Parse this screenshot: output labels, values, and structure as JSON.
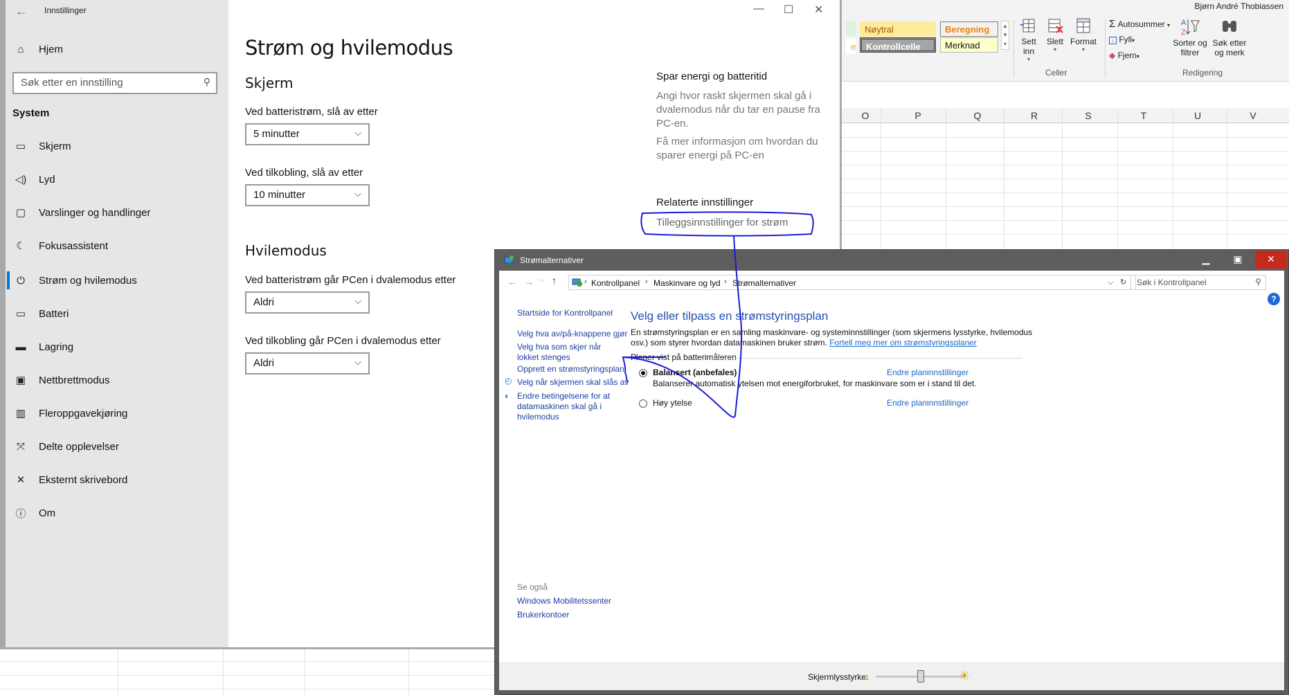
{
  "excel": {
    "user_name": "Bjørn André Thobiassen",
    "styles": {
      "neutral": "Nøytral",
      "calculation": "Beregning",
      "check_cell": "Kontrollcelle",
      "note": "Merknad"
    },
    "cells_group": {
      "insert": "Sett inn",
      "delete": "Slett",
      "format": "Format",
      "label": "Celler"
    },
    "editing_group": {
      "autosum": "Autosummer",
      "fill": "Fyll",
      "clear": "Fjern",
      "sort_filter": "Sorter og filtrer",
      "find_select": "Søk etter og merk",
      "label": "Redigering"
    },
    "column_headers": [
      "O",
      "P",
      "Q",
      "R",
      "S",
      "T",
      "U",
      "V"
    ]
  },
  "settings": {
    "window_title": "Innstillinger",
    "home_label": "Hjem",
    "search_placeholder": "Søk etter en innstilling",
    "section_label": "System",
    "nav_items": [
      {
        "label": "Skjerm",
        "icon": "monitor-icon"
      },
      {
        "label": "Lyd",
        "icon": "speaker-icon"
      },
      {
        "label": "Varslinger og handlinger",
        "icon": "notification-icon"
      },
      {
        "label": "Fokusassistent",
        "icon": "moon-icon"
      },
      {
        "label": "Strøm og hvilemodus",
        "icon": "power-icon"
      },
      {
        "label": "Batteri",
        "icon": "battery-icon"
      },
      {
        "label": "Lagring",
        "icon": "storage-icon"
      },
      {
        "label": "Nettbrettmodus",
        "icon": "tablet-icon"
      },
      {
        "label": "Fleroppgavekjøring",
        "icon": "multitask-icon"
      },
      {
        "label": "Delte opplevelser",
        "icon": "share-icon"
      },
      {
        "label": "Eksternt skrivebord",
        "icon": "remote-icon"
      },
      {
        "label": "Om",
        "icon": "info-icon"
      }
    ],
    "page_title": "Strøm og hvilemodus",
    "screen_heading": "Skjerm",
    "screen_battery_label": "Ved batteristrøm, slå av etter",
    "screen_battery_value": "5 minutter",
    "screen_plugged_label": "Ved tilkobling, slå av etter",
    "screen_plugged_value": "10 minutter",
    "sleep_heading": "Hvilemodus",
    "sleep_battery_label": "Ved batteristrøm går PCen i dvalemodus etter",
    "sleep_battery_value": "Aldri",
    "sleep_plugged_label": "Ved tilkobling går PCen i dvalemodus etter",
    "sleep_plugged_value": "Aldri",
    "save_heading": "Spar energi og batteritid",
    "save_text": "Angi hvor raskt skjermen skal gå i dvalemodus når du tar en pause fra PC-en.",
    "save_more": "Få mer informasjon om hvordan du sparer energi på PC-en",
    "related_heading": "Relaterte innstillinger",
    "related_link": "Tilleggsinnstillinger for strøm"
  },
  "power": {
    "window_title": "Strømalternativer",
    "breadcrumb": [
      "Kontrollpanel",
      "Maskinvare og lyd",
      "Strømalternativer"
    ],
    "search_placeholder": "Søk i Kontrollpanel",
    "sidebar_links": [
      "Startside for Kontrollpanel",
      "Velg hva av/på-knappene gjør",
      "Velg hva som skjer når lokket stenges",
      "Opprett en strømstyringsplan",
      "Velg når skjermen skal slås av",
      "Endre betingelsene for at datamaskinen skal gå i hvilemodus"
    ],
    "see_also_label": "Se også",
    "see_also_links": [
      "Windows Mobilitetssenter",
      "Brukerkontoer"
    ],
    "heading": "Velg eller tilpass en strømstyringsplan",
    "description": "En strømstyringsplan er en samling maskinvare- og systeminnstillinger (som skjermens lysstyrke, hvilemodus osv.) som styrer hvordan datamaskinen bruker strøm.",
    "learn_more_link": "Fortell meg mer om strømstyringsplaner",
    "plans_label": "Planer vist på batterimåleren",
    "plan_balanced_name": "Balansert (anbefales)",
    "plan_balanced_desc": "Balanserer automatisk ytelsen mot energiforbruket, for maskinvare som er i stand til det.",
    "plan_high_name": "Høy ytelse",
    "change_plan_link": "Endre planinnstillinger",
    "brightness_label": "Skjermlysstyrke:",
    "brightness_level": 0.5
  }
}
